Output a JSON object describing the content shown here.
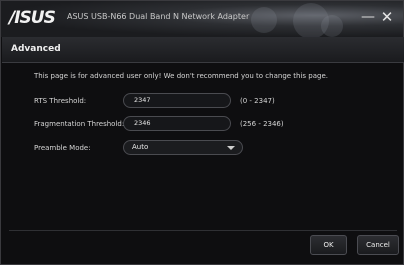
{
  "window": {
    "brand": "/ISUS",
    "title": "ASUS USB-N66 Dual Band N Network Adapter",
    "minimize_glyph": "—",
    "close_glyph": "✕"
  },
  "section": {
    "title": "Advanced"
  },
  "warning": "This page is for advanced user only! We don't recommend you to change this page.",
  "fields": {
    "rts": {
      "label": "RTS Threshold:",
      "value": "2347",
      "range": "(0 - 2347)"
    },
    "fragmentation": {
      "label": "Fragmentation Threshold:",
      "value": "2346",
      "range": "(256 - 2346)"
    },
    "preamble": {
      "label": "Preamble Mode:",
      "value": "Auto"
    }
  },
  "buttons": {
    "ok": "OK",
    "cancel": "Cancel"
  }
}
